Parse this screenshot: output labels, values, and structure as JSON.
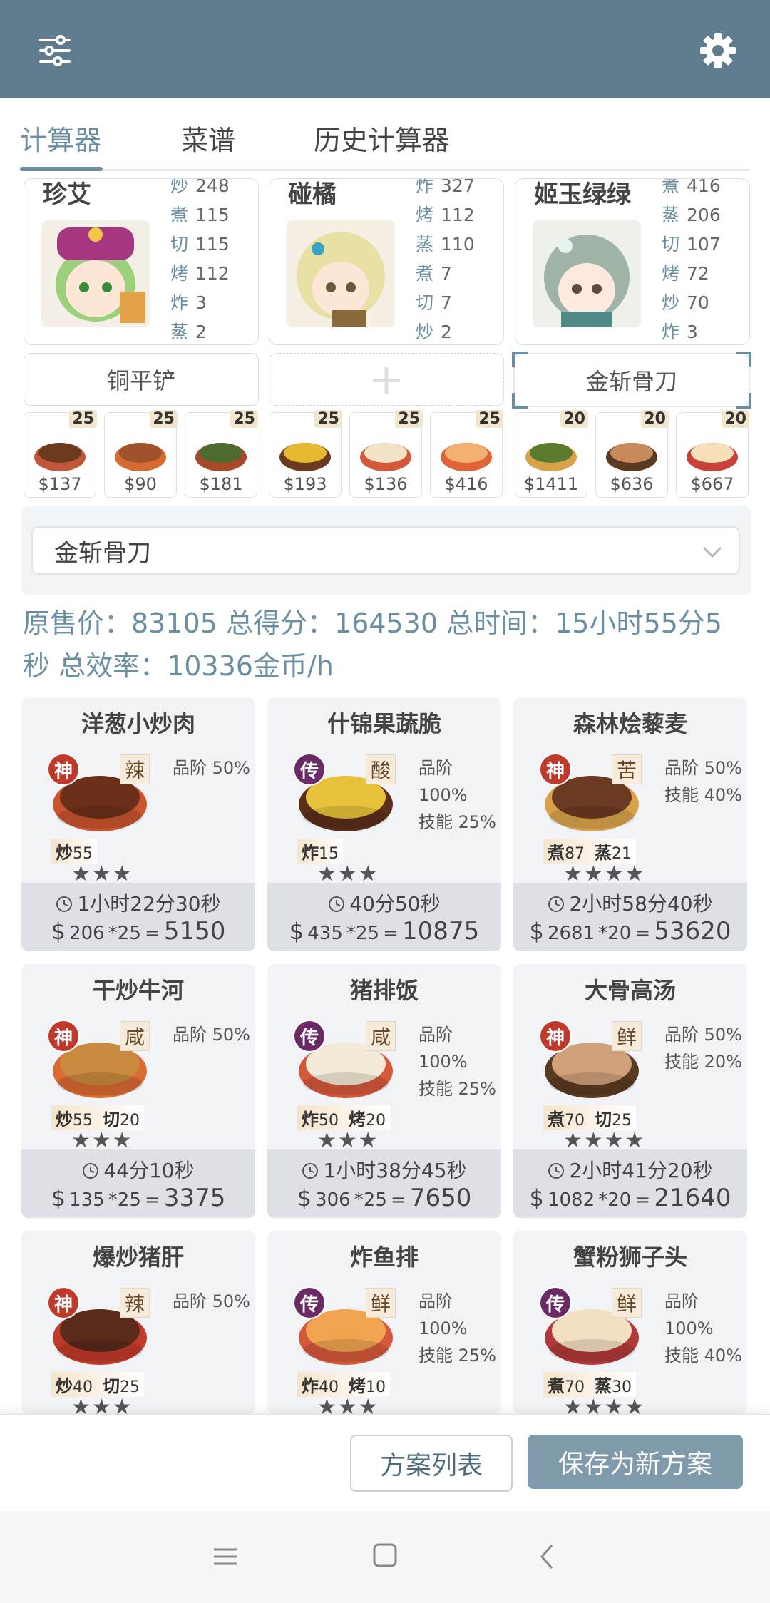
{
  "tabs": [
    "计算器",
    "菜谱",
    "历史计算器"
  ],
  "chefs": [
    {
      "name": "珍艾",
      "skills": [
        {
          "k": "炒",
          "v": "248"
        },
        {
          "k": "煮",
          "v": "115"
        },
        {
          "k": "切",
          "v": "115"
        },
        {
          "k": "烤",
          "v": "112"
        },
        {
          "k": "炸",
          "v": "3"
        },
        {
          "k": "蒸",
          "v": "2"
        }
      ]
    },
    {
      "name": "碰橘",
      "skills": [
        {
          "k": "炸",
          "v": "327"
        },
        {
          "k": "烤",
          "v": "112"
        },
        {
          "k": "蒸",
          "v": "110"
        },
        {
          "k": "煮",
          "v": "7"
        },
        {
          "k": "切",
          "v": "7"
        },
        {
          "k": "炒",
          "v": "2"
        }
      ]
    },
    {
      "name": "姬玉绿绿",
      "skills": [
        {
          "k": "煮",
          "v": "416"
        },
        {
          "k": "蒸",
          "v": "206"
        },
        {
          "k": "切",
          "v": "107"
        },
        {
          "k": "烤",
          "v": "72"
        },
        {
          "k": "炒",
          "v": "70"
        },
        {
          "k": "炸",
          "v": "3"
        }
      ]
    }
  ],
  "equipment": {
    "slot1": "铜平铲",
    "slot2_symbol": "+",
    "slot3": "金斩骨刀"
  },
  "mini_recipes": [
    {
      "count": "25",
      "price": "$137"
    },
    {
      "count": "25",
      "price": "$90"
    },
    {
      "count": "25",
      "price": "$181"
    },
    {
      "count": "25",
      "price": "$193"
    },
    {
      "count": "25",
      "price": "$136"
    },
    {
      "count": "25",
      "price": "$416"
    },
    {
      "count": "20",
      "price": "$1411"
    },
    {
      "count": "20",
      "price": "$636"
    },
    {
      "count": "20",
      "price": "$667"
    }
  ],
  "select": {
    "value": "金斩骨刀"
  },
  "summary": {
    "line1": "原售价：83105 总得分：164530 总时间：15小时55分5",
    "line2": "秒 总效率：10336金币/h"
  },
  "recipes": [
    {
      "name": "洋葱小炒肉",
      "tier": "神",
      "flavor": "辣",
      "grade": "品阶 50%",
      "skill": "",
      "reqs": [
        {
          "k": "炒",
          "v": "55"
        }
      ],
      "stars": "★★★",
      "time": "1小时22分30秒",
      "price": "206",
      "mult": "*25",
      "total": "5150"
    },
    {
      "name": "什锦果蔬脆",
      "tier": "传",
      "flavor": "酸",
      "grade": "品阶 100%",
      "skill": "技能 25%",
      "reqs": [
        {
          "k": "炸",
          "v": "15"
        }
      ],
      "stars": "★★★",
      "time": "40分50秒",
      "price": "435",
      "mult": "*25",
      "total": "10875"
    },
    {
      "name": "森林烩藜麦",
      "tier": "神",
      "flavor": "苦",
      "grade": "品阶 50%",
      "skill": "技能 40%",
      "reqs": [
        {
          "k": "煮",
          "v": "87"
        },
        {
          "k": "蒸",
          "v": "21"
        }
      ],
      "stars": "★★★★",
      "time": "2小时58分40秒",
      "price": "2681",
      "mult": "*20",
      "total": "53620"
    },
    {
      "name": "干炒牛河",
      "tier": "神",
      "flavor": "咸",
      "grade": "品阶 50%",
      "skill": "",
      "reqs": [
        {
          "k": "炒",
          "v": "55"
        },
        {
          "k": "切",
          "v": "20"
        }
      ],
      "stars": "★★★",
      "time": "44分10秒",
      "price": "135",
      "mult": "*25",
      "total": "3375"
    },
    {
      "name": "猪排饭",
      "tier": "传",
      "flavor": "咸",
      "grade": "品阶 100%",
      "skill": "技能 25%",
      "reqs": [
        {
          "k": "炸",
          "v": "50"
        },
        {
          "k": "烤",
          "v": "20"
        }
      ],
      "stars": "★★★",
      "time": "1小时38分45秒",
      "price": "306",
      "mult": "*25",
      "total": "7650"
    },
    {
      "name": "大骨高汤",
      "tier": "神",
      "flavor": "鲜",
      "grade": "品阶 50%",
      "skill": "技能 20%",
      "reqs": [
        {
          "k": "煮",
          "v": "70"
        },
        {
          "k": "切",
          "v": "25"
        }
      ],
      "stars": "★★★★",
      "time": "2小时41分20秒",
      "price": "1082",
      "mult": "*20",
      "total": "21640"
    },
    {
      "name": "爆炒猪肝",
      "tier": "神",
      "flavor": "辣",
      "grade": "品阶 50%",
      "skill": "",
      "reqs": [
        {
          "k": "炒",
          "v": "40"
        },
        {
          "k": "切",
          "v": "25"
        }
      ],
      "stars": "★★★",
      "time": "",
      "price": "",
      "mult": "",
      "total": ""
    },
    {
      "name": "炸鱼排",
      "tier": "传",
      "flavor": "鲜",
      "grade": "品阶 100%",
      "skill": "技能 25%",
      "reqs": [
        {
          "k": "炸",
          "v": "40"
        },
        {
          "k": "烤",
          "v": "10"
        }
      ],
      "stars": "★★★",
      "time": "",
      "price": "",
      "mult": "",
      "total": ""
    },
    {
      "name": "蟹粉狮子头",
      "tier": "传",
      "flavor": "鲜",
      "grade": "品阶 100%",
      "skill": "技能 40%",
      "reqs": [
        {
          "k": "煮",
          "v": "70"
        },
        {
          "k": "蒸",
          "v": "30"
        }
      ],
      "stars": "★★★★",
      "time": "",
      "price": "",
      "mult": "",
      "total": ""
    }
  ],
  "buttons": {
    "plan_list": "方案列表",
    "save_new": "保存为新方案"
  },
  "colors": {
    "appbar": "#5f7d8e",
    "accent": "#6a8fa3",
    "tier_shen": "#c0392b",
    "tier_chuan": "#6b2a66",
    "primary_button": "#7f9bab"
  },
  "icons": {
    "filter": "sliders-icon",
    "settings": "gear-icon",
    "dropdown": "chevron-down-icon",
    "clock": "clock-icon",
    "nav_menu": "menu-icon",
    "nav_home": "square-icon",
    "nav_back": "back-icon"
  }
}
